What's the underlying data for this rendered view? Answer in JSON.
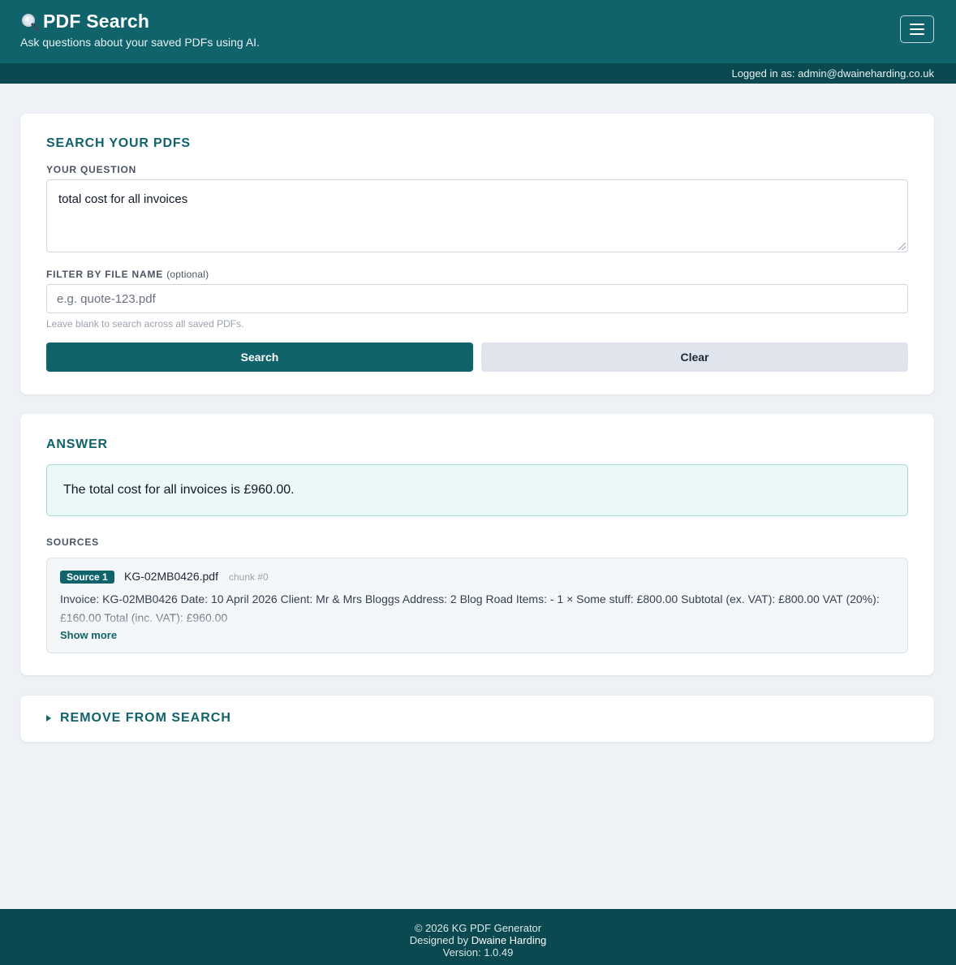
{
  "header": {
    "title": "PDF Search",
    "subtitle": "Ask questions about your saved PDFs using AI.",
    "icon": "magnifying-glass-icon",
    "menu_icon": "hamburger-menu-icon"
  },
  "userbar": {
    "text": "Logged in as: admin@dwaineharding.co.uk"
  },
  "search_card": {
    "title": "SEARCH YOUR PDFS",
    "question_label": "YOUR QUESTION",
    "question_value": "total cost for all invoices",
    "filter_label": "FILTER BY FILE NAME",
    "filter_optional": "(optional)",
    "filter_placeholder": "e.g. quote-123.pdf",
    "filter_value": "",
    "hint": "Leave blank to search across all saved PDFs.",
    "search_button": "Search",
    "clear_button": "Clear"
  },
  "answer_card": {
    "title": "ANSWER",
    "answer_text": "The total cost for all invoices is £960.00.",
    "sources_label": "SOURCES",
    "sources": [
      {
        "badge": "Source 1",
        "file_name": "KG-02MB0426.pdf",
        "chunk": "chunk #0",
        "text": "Invoice: KG-02MB0426 Date: 10 April 2026 Client: Mr & Mrs Bloggs Address: 2 Blog Road Items: - 1 × Some stuff: £800.00 Subtotal (ex. VAT): £800.00 VAT (20%): £160.00 Total (inc. VAT): £960.00",
        "show_more": "Show more"
      }
    ]
  },
  "remove_card": {
    "title": "REMOVE FROM SEARCH",
    "icon": "caret-right-icon"
  },
  "footer": {
    "copyright": "© 2026 KG PDF Generator",
    "designed_by_prefix": "Designed by",
    "author": "Dwaine Harding",
    "version": "Version: 1.0.49"
  },
  "colors": {
    "brand": "#10636a",
    "brand_dark": "#0a4950",
    "background": "#eef1f5",
    "answer_bg": "#ebf8f7"
  }
}
